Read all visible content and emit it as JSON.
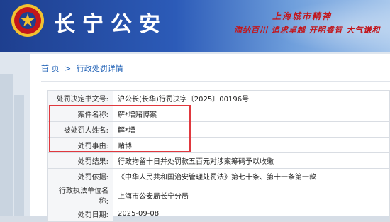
{
  "header": {
    "title": "长宁公安",
    "spirit_title": "上海城市精神",
    "spirit_text": "海纳百川 追求卓越 开明睿智 大气谦和"
  },
  "breadcrumb": {
    "home": "首 页",
    "separator": ">",
    "current": "行政处罚详情"
  },
  "record": [
    {
      "label": "处罚决定书文号:",
      "value": "沪公长(长华)行罚决字〔2025〕00196号"
    },
    {
      "label": "案件名称:",
      "value": "解*增赌博案"
    },
    {
      "label": "被处罚人姓名:",
      "value": "解*增"
    },
    {
      "label": "处罚事由:",
      "value": "赌博"
    },
    {
      "label": "处罚结果:",
      "value": "行政拘留十日并处罚款五百元对涉案筹码予以收缴"
    },
    {
      "label": "处罚依据:",
      "value": "《中华人民共和国治安管理处罚法》第七十条、第十一条第一款"
    },
    {
      "label": "行政执法单位名称:",
      "value": "上海市公安局长宁分局"
    },
    {
      "label": "处罚日期:",
      "value": "2025-09-08"
    }
  ],
  "colors": {
    "brand": "#1e3f8f",
    "link": "#1d5fb5",
    "highlight": "#e0383e",
    "emblem_red": "#c2161c",
    "emblem_gold": "#f2c230"
  }
}
